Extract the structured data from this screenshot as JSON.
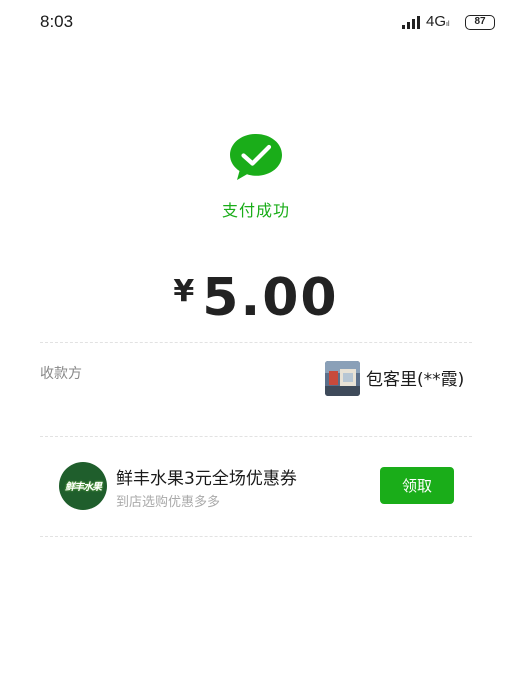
{
  "status_bar": {
    "time": "8:03",
    "network": "4G",
    "network_sub": "ıl",
    "battery": "87"
  },
  "payment": {
    "status_text": "支付成功",
    "currency_symbol": "¥",
    "amount": "5.00",
    "accent_color": "#1aad19"
  },
  "payee": {
    "label": "收款方",
    "name": "包客里(**霞)"
  },
  "coupon": {
    "logo_text": "鲜丰水果",
    "title": "鲜丰水果3元全场优惠券",
    "subtitle": "到店选购优惠多多",
    "button_label": "领取"
  },
  "icons": {
    "success": "wechat-pay-check-icon",
    "signal": "signal-bars-icon",
    "battery": "battery-icon"
  }
}
